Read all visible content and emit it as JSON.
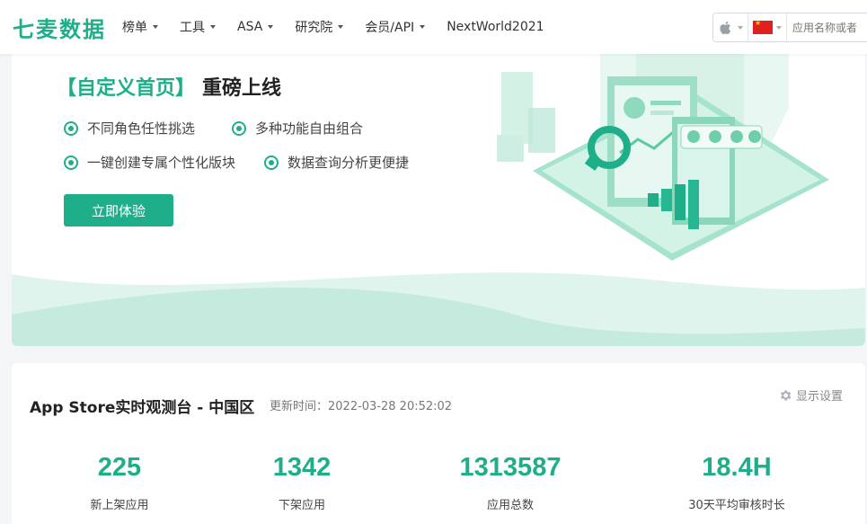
{
  "brand": {
    "logo_text": "七麦数据",
    "accent_color": "#1fae8a"
  },
  "nav": [
    {
      "label": "榜单",
      "has_dropdown": true
    },
    {
      "label": "工具",
      "has_dropdown": true
    },
    {
      "label": "ASA",
      "has_dropdown": true
    },
    {
      "label": "研究院",
      "has_dropdown": true
    },
    {
      "label": "会员/API",
      "has_dropdown": true
    },
    {
      "label": "NextWorld2021",
      "has_dropdown": false
    }
  ],
  "search": {
    "platform_icon": "apple-icon",
    "country_icon": "china-flag-icon",
    "placeholder": "应用名称或者"
  },
  "banner": {
    "title_accent": "【自定义首页】",
    "title_rest": "重磅上线",
    "features": [
      "不同角色任性挑选",
      "多种功能自由组合",
      "一键创建专属个性化版块",
      "数据查询分析更便捷"
    ],
    "cta_label": "立即体验"
  },
  "dashboard": {
    "title": "App Store实时观测台 - 中国区",
    "updated_label": "更新时间：2022-03-28 20:52:02",
    "settings_label": "显示设置",
    "metrics": [
      {
        "value": "225",
        "label": "新上架应用"
      },
      {
        "value": "1342",
        "label": "下架应用"
      },
      {
        "value": "1313587",
        "label": "应用总数"
      },
      {
        "value": "18.4H",
        "label": "30天平均审核时长"
      }
    ]
  }
}
